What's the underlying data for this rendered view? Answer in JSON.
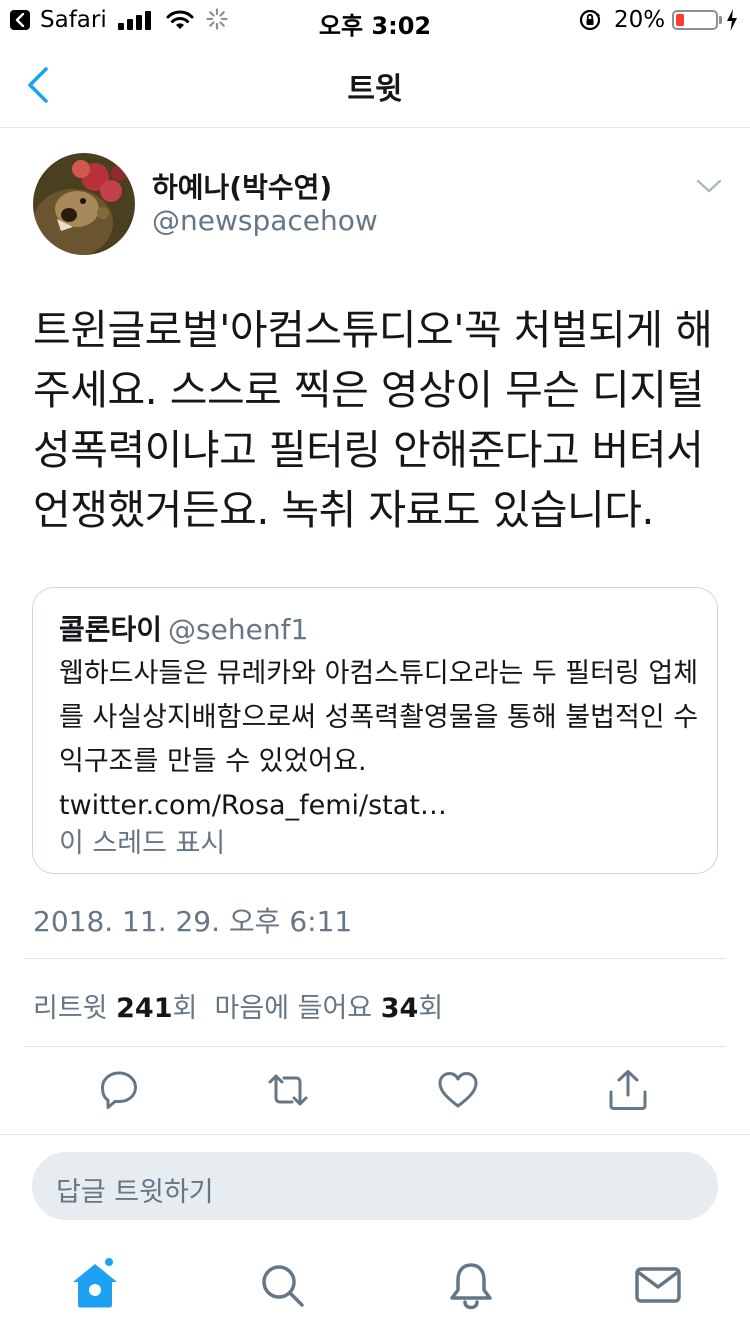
{
  "status_bar": {
    "carrier": "Safari",
    "time": "오후 3:02",
    "battery_percent": "20%",
    "battery_level": 0.2
  },
  "nav": {
    "title": "트윗"
  },
  "tweet": {
    "author_name": "하예나(박수연)",
    "author_handle": "@newspacehow",
    "text": "트윈글로벌'아컴스튜디오'꼭 처벌되게 해주세요. 스스로 찍은 영상이 무슨 디지털 성폭력이냐고 필터링 안해준다고 버텨서 언쟁했거든요. 녹취 자료도 있습니다.",
    "timestamp": "2018. 11. 29. 오후 6:11"
  },
  "quote": {
    "author_name": "콜론타이",
    "author_handle": "@sehenf1",
    "text": "웹하드사들은 뮤레카와 아컴스튜디오라는 두 필터링 업체를 사실상지배함으로써 성폭력촬영물을 통해 불법적인 수익구조를 만들 수 있었어요. twitter.com/Rosa_femi/stat…",
    "thread_link": "이 스레드 표시"
  },
  "stats": {
    "retweet_label": "리트윗",
    "retweet_count": "241",
    "retweet_unit": "회",
    "like_label": "마음에 들어요",
    "like_count": "34",
    "like_unit": "회"
  },
  "actions": [
    "reply-icon",
    "retweet-icon",
    "like-icon",
    "share-icon"
  ],
  "reply_box": {
    "placeholder": "답글 트윗하기"
  },
  "tab_bar": [
    "home-icon",
    "search-icon",
    "notifications-icon",
    "messages-icon"
  ],
  "colors": {
    "accent": "#1da1f2",
    "secondary_text": "#657786",
    "divider": "#e1e8ed",
    "reply_box_bg": "#e6ecf0"
  }
}
